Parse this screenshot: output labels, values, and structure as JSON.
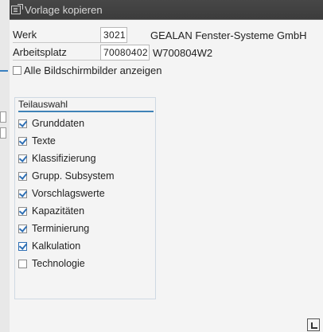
{
  "window": {
    "title": "Vorlage kopieren",
    "icon": "copy-template-icon"
  },
  "fields": [
    {
      "label": "Werk",
      "value": "3021",
      "description": "GEALAN Fenster-Systeme GmbH"
    },
    {
      "label": "Arbeitsplatz",
      "value": "70080402",
      "description": "W700804W2"
    }
  ],
  "show_all_screens": {
    "label": "Alle Bildschirmbilder anzeigen",
    "checked": false
  },
  "selection": {
    "title": "Teilauswahl",
    "options": [
      {
        "label": "Grunddaten",
        "checked": true
      },
      {
        "label": "Texte",
        "checked": true
      },
      {
        "label": "Klassifizierung",
        "checked": true
      },
      {
        "label": "Grupp. Subsystem",
        "checked": true
      },
      {
        "label": "Vorschlagswerte",
        "checked": true
      },
      {
        "label": "Kapazitäten",
        "checked": true
      },
      {
        "label": "Terminierung",
        "checked": true
      },
      {
        "label": "Kalkulation",
        "checked": true,
        "focused": true
      },
      {
        "label": "Technologie",
        "checked": false
      }
    ]
  },
  "colors": {
    "accent": "#3f82b7",
    "titlebar": "#3c3c3c",
    "background": "#f4f4f4"
  }
}
